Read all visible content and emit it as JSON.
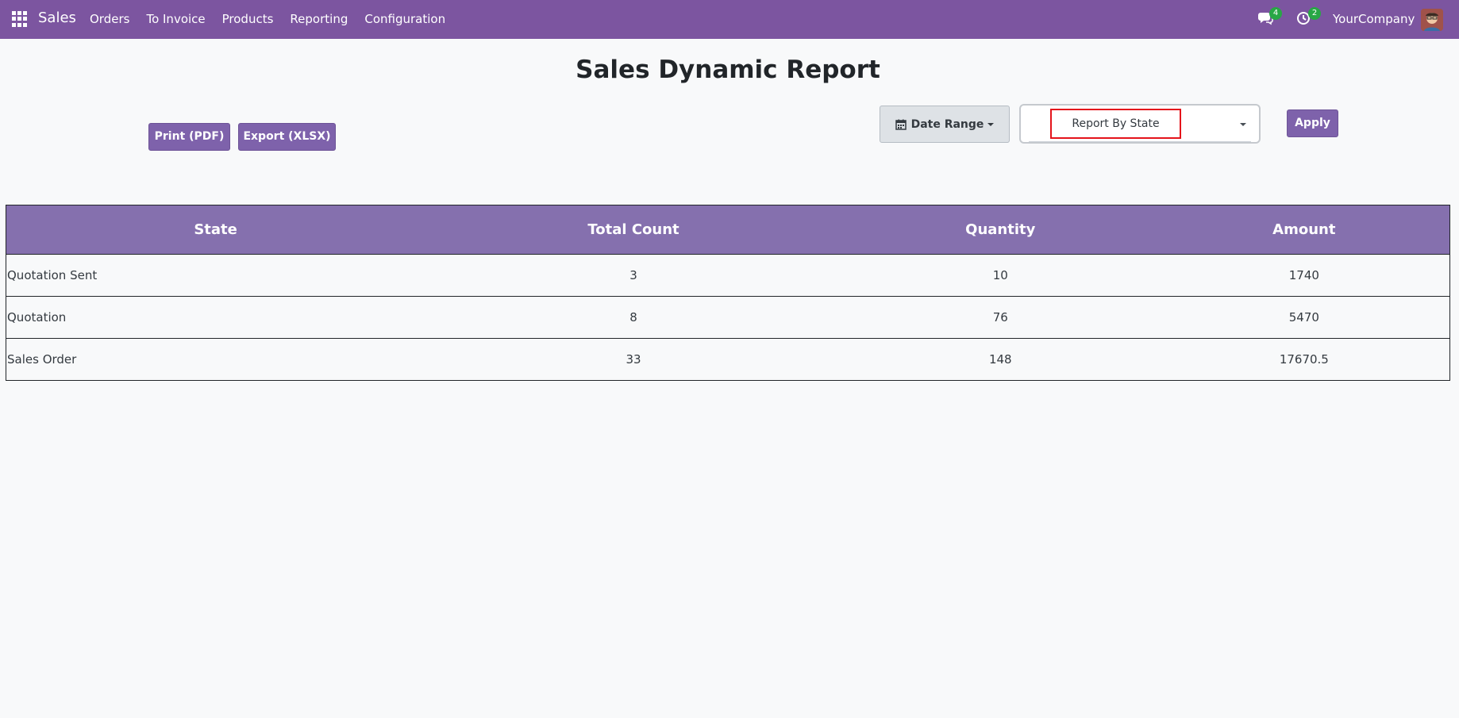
{
  "topbar": {
    "brand": "Sales",
    "menu": [
      "Orders",
      "To Invoice",
      "Products",
      "Reporting",
      "Configuration"
    ],
    "messages_badge": "4",
    "activity_badge": "2",
    "company": "YourCompany",
    "colors": {
      "bar": "#7c55a0",
      "badge": "#28a745"
    }
  },
  "page": {
    "title": "Sales Dynamic Report"
  },
  "actions": {
    "print_label": "Print (PDF)",
    "export_label": "Export (XLSX)",
    "date_range_label": "Date Range",
    "report_select_value": "Report By State",
    "apply_label": "Apply"
  },
  "table": {
    "headers": [
      "State",
      "Total Count",
      "Quantity",
      "Amount"
    ],
    "rows": [
      [
        "Quotation Sent",
        "3",
        "10",
        "1740"
      ],
      [
        "Quotation",
        "8",
        "76",
        "5470"
      ],
      [
        "Sales Order",
        "33",
        "148",
        "17670.5"
      ]
    ]
  },
  "icons": {
    "apps": "grid-icon",
    "messages": "chat-bubble-icon",
    "activity": "clock-icon",
    "date_range": "calendar-icon",
    "select": "chevron-down-icon"
  }
}
